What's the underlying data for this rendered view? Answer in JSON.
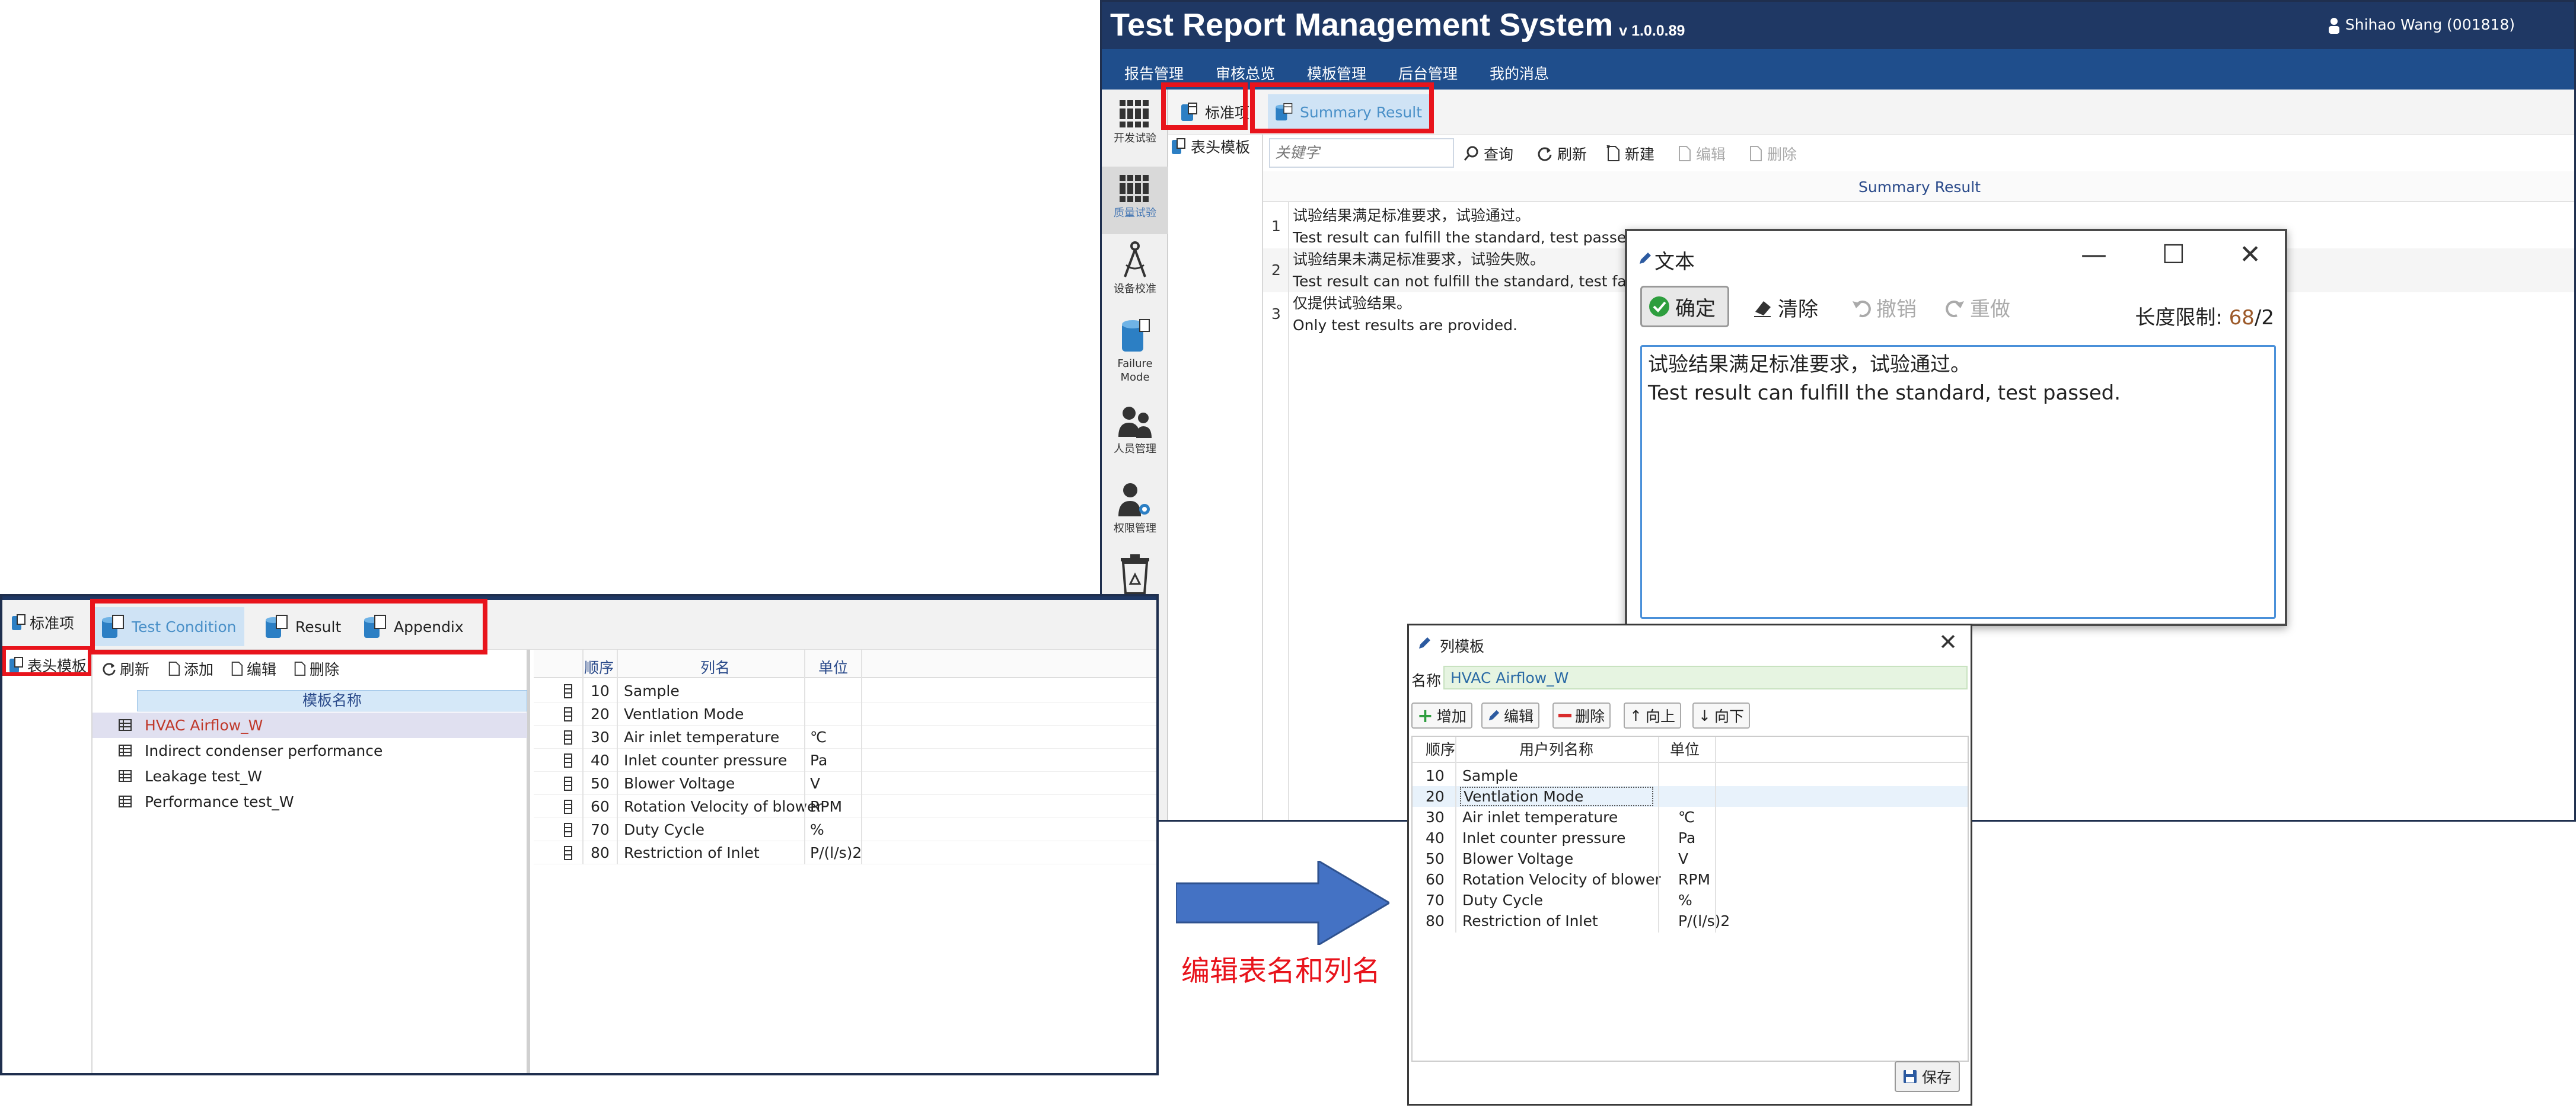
{
  "main_window": {
    "title": "Test Report Management System",
    "version": "v 1.0.0.89",
    "user": "Shihao Wang (001818)",
    "menu": [
      "报告管理",
      "审核总览",
      "模板管理",
      "后台管理",
      "我的消息"
    ],
    "left_nav": [
      {
        "label": "开发试验",
        "icon": "books-icon"
      },
      {
        "label": "质量试验",
        "icon": "books-icon"
      },
      {
        "label": "设备校准",
        "icon": "compass-icon"
      },
      {
        "label": "Failure Mode",
        "icon": "database-icon"
      },
      {
        "label": "人员管理",
        "icon": "people-icon"
      },
      {
        "label": "权限管理",
        "icon": "user-gear-icon"
      },
      {
        "label": "",
        "icon": "recycle-bin-icon"
      }
    ],
    "tabs": [
      {
        "label": "标准项",
        "icon": "table-db-icon"
      },
      {
        "label": "Summary Result",
        "icon": "table-db-icon"
      }
    ],
    "sub_nav": "表头模板",
    "toolbar": {
      "keyword_placeholder": "关键字",
      "query": "查询",
      "refresh": "刷新",
      "new": "新建",
      "edit": "编辑",
      "delete": "删除"
    },
    "grid": {
      "header": "Summary Result",
      "rows": [
        {
          "num": "1",
          "lines": [
            "试验结果满足标准要求，试验通过。",
            "Test result can fulfill the standard, test passed."
          ]
        },
        {
          "num": "2",
          "lines": [
            "试验结果未满足标准要求，试验失败。",
            "Test result can not fulfill the standard, test failed."
          ]
        },
        {
          "num": "3",
          "lines": [
            "仅提供试验结果。",
            "Only test results are provided."
          ]
        }
      ]
    }
  },
  "text_dialog": {
    "title": "文本",
    "ok": "确定",
    "clear": "清除",
    "undo": "撤销",
    "redo": "重做",
    "length_label": "长度限制:",
    "length_used": "68",
    "length_sep": "/",
    "length_max": "2",
    "content": "试验结果满足标准要求，试验通过。\nTest result can fulfill the standard, test passed."
  },
  "template_window": {
    "nav_std": "标准项",
    "nav_header": "表头模板",
    "tabs": [
      "Test Condition",
      "Result",
      "Appendix"
    ],
    "mid_toolbar": {
      "refresh": "刷新",
      "add": "添加",
      "edit": "编辑",
      "delete": "删除"
    },
    "template_header": "模板名称",
    "templates": [
      "HVAC Airflow_W",
      "Indirect condenser performance",
      "Leakage test_W",
      "Performance test_W"
    ],
    "columns_header": {
      "order": "顺序",
      "name": "列名",
      "unit": "单位"
    },
    "columns": [
      {
        "order": "10",
        "name": "Sample",
        "unit": ""
      },
      {
        "order": "20",
        "name": "Ventlation Mode",
        "unit": ""
      },
      {
        "order": "30",
        "name": "Air inlet temperature",
        "unit": "℃"
      },
      {
        "order": "40",
        "name": "Inlet counter pressure",
        "unit": "Pa"
      },
      {
        "order": "50",
        "name": "Blower Voltage",
        "unit": "V"
      },
      {
        "order": "60",
        "name": "Rotation Velocity of blower",
        "unit": "RPM"
      },
      {
        "order": "70",
        "name": "Duty Cycle",
        "unit": "%"
      },
      {
        "order": "80",
        "name": "Restriction of Inlet",
        "unit": "P/(l/s)2"
      }
    ]
  },
  "column_dialog": {
    "title": "列模板",
    "name_label": "名称",
    "name_value": "HVAC Airflow_W",
    "buttons": {
      "add": "增加",
      "edit": "编辑",
      "delete": "删除",
      "up": "向上",
      "down": "向下"
    },
    "grid_header": {
      "order": "顺序",
      "name": "用户列名称",
      "unit": "单位"
    },
    "rows": [
      {
        "order": "10",
        "name": "Sample",
        "unit": ""
      },
      {
        "order": "20",
        "name": "Ventlation Mode",
        "unit": ""
      },
      {
        "order": "30",
        "name": "Air inlet temperature",
        "unit": "℃"
      },
      {
        "order": "40",
        "name": "Inlet counter pressure",
        "unit": "Pa"
      },
      {
        "order": "50",
        "name": "Blower Voltage",
        "unit": "V"
      },
      {
        "order": "60",
        "name": "Rotation Velocity of blower",
        "unit": "RPM"
      },
      {
        "order": "70",
        "name": "Duty Cycle",
        "unit": "%"
      },
      {
        "order": "80",
        "name": "Restriction of Inlet",
        "unit": "P/(l/s)2"
      }
    ],
    "save": "保存"
  },
  "caption": "编辑表名和列名",
  "colors": {
    "accent_red": "#e8141c",
    "title_navy": "#1f3864",
    "menu_blue": "#1f4e8c",
    "arrow_blue": "#4472c4"
  }
}
